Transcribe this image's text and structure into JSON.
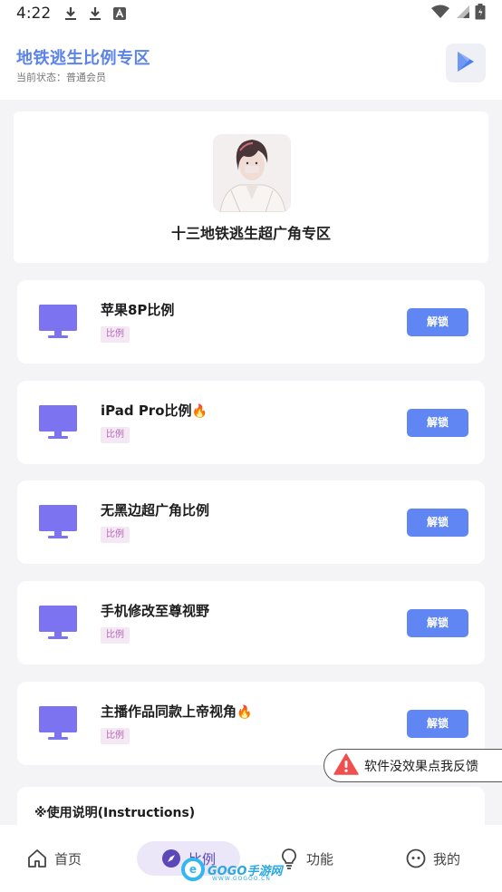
{
  "status_bar": {
    "time": "4:22",
    "icons": [
      "download-icon",
      "download-icon",
      "font-icon",
      "wifi-icon",
      "signal-icon",
      "battery-icon"
    ]
  },
  "header": {
    "title": "地铁逃生比例专区",
    "subtitle": "当前状态：普通会员",
    "action_icon": "play-store-icon"
  },
  "hero": {
    "title": "十三地铁逃生超广角专区",
    "avatar_icon": "avatar"
  },
  "items": [
    {
      "name": "苹果8P比例",
      "fire": false,
      "tag": "比例",
      "button": "解锁"
    },
    {
      "name": "iPad Pro比例",
      "fire": true,
      "tag": "比例",
      "button": "解锁"
    },
    {
      "name": "无黑边超广角比例",
      "fire": false,
      "tag": "比例",
      "button": "解锁"
    },
    {
      "name": "手机修改至尊视野",
      "fire": false,
      "tag": "比例",
      "button": "解锁"
    },
    {
      "name": "主播作品同款上帝视角",
      "fire": true,
      "tag": "比例",
      "button": "解锁"
    }
  ],
  "feedback": {
    "text": "软件没效果点我反馈",
    "icon": "warning-icon"
  },
  "instructions": {
    "title": "※使用说明(Instructions)"
  },
  "tabs": [
    {
      "label": "首页",
      "icon": "home-icon",
      "active": false
    },
    {
      "label": "比例",
      "icon": "compass-icon",
      "active": true
    },
    {
      "label": "功能",
      "icon": "lightbulb-icon",
      "active": false
    },
    {
      "label": "我的",
      "icon": "smile-icon",
      "active": false
    }
  ],
  "watermark": {
    "text": "GOGO手游网",
    "sub": "WWW.GOGOO.CN",
    "badge": "e"
  },
  "colors": {
    "accent": "#5f86f2",
    "title": "#5c84e8",
    "monitor": "#7b73f0",
    "tag_bg": "#f4e8f4",
    "tag_fg": "#b569b5",
    "warning": "#ef4f4f"
  }
}
